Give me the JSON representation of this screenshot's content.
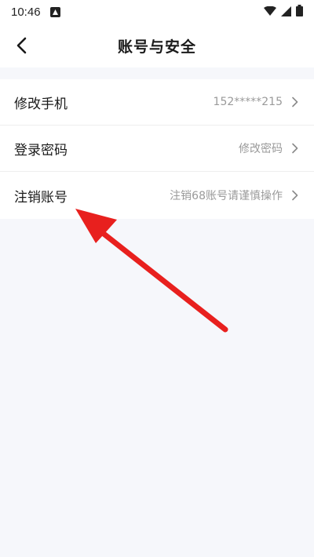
{
  "status_bar": {
    "time": "10:46"
  },
  "header": {
    "title": "账号与安全"
  },
  "rows": [
    {
      "label": "修改手机",
      "value": "152*****215"
    },
    {
      "label": "登录密码",
      "value": "修改密码"
    },
    {
      "label": "注销账号",
      "value": "注销68账号请谨慎操作"
    }
  ],
  "colors": {
    "arrow": "#e8201e",
    "background": "#f6f7fb"
  }
}
